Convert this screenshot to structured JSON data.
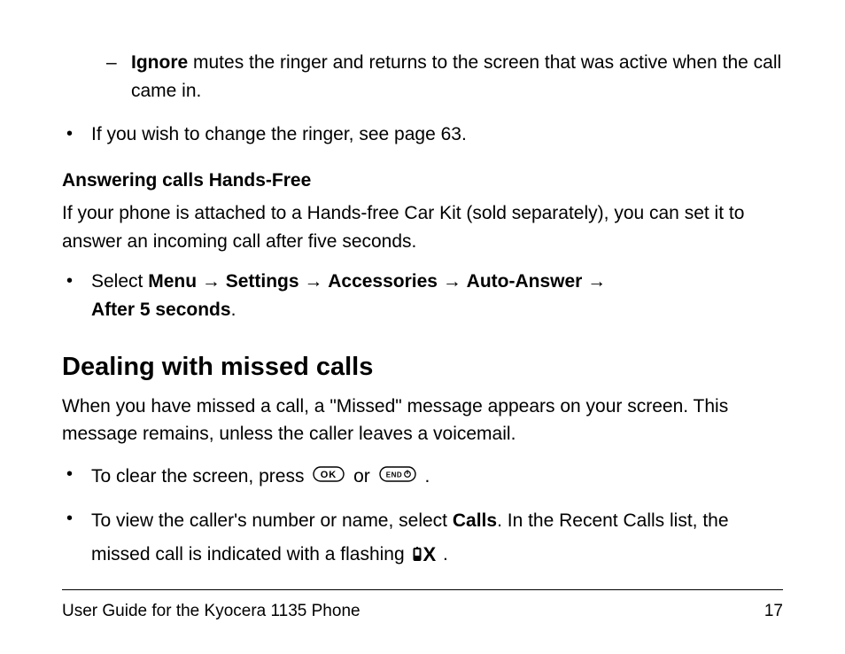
{
  "dash_item": {
    "bold": "Ignore",
    "rest": " mutes the ringer and returns to the screen that was active when the call came in."
  },
  "bullet_change_ringer": "If you wish to change the ringer, see page 63.",
  "handsfree": {
    "heading": "Answering calls Hands-Free",
    "para": "If your phone is attached to a Hands-free Car Kit (sold separately), you can set it to answer an incoming call after five seconds.",
    "path_prefix": "Select ",
    "menu": "Menu",
    "settings": "Settings",
    "accessories": "Accessories",
    "auto_answer": "Auto-Answer",
    "after5": "After 5 seconds",
    "arrow": " → "
  },
  "missed": {
    "heading": "Dealing with missed calls",
    "para": "When you have missed a call, a \"Missed\" message appears on your screen. This message remains, unless the caller leaves a voicemail.",
    "clear_prefix": "To clear the screen, press ",
    "or": " or ",
    "period": " .",
    "view_prefix": "To view the caller's number or name, select ",
    "calls": "Calls",
    "view_suffix": ". In the Recent Calls list, the missed call is indicated with a flashing "
  },
  "footer": {
    "title": "User Guide for the Kyocera 1135 Phone",
    "page": "17"
  },
  "glyphs": {
    "bullet": "•",
    "dash": "–"
  }
}
